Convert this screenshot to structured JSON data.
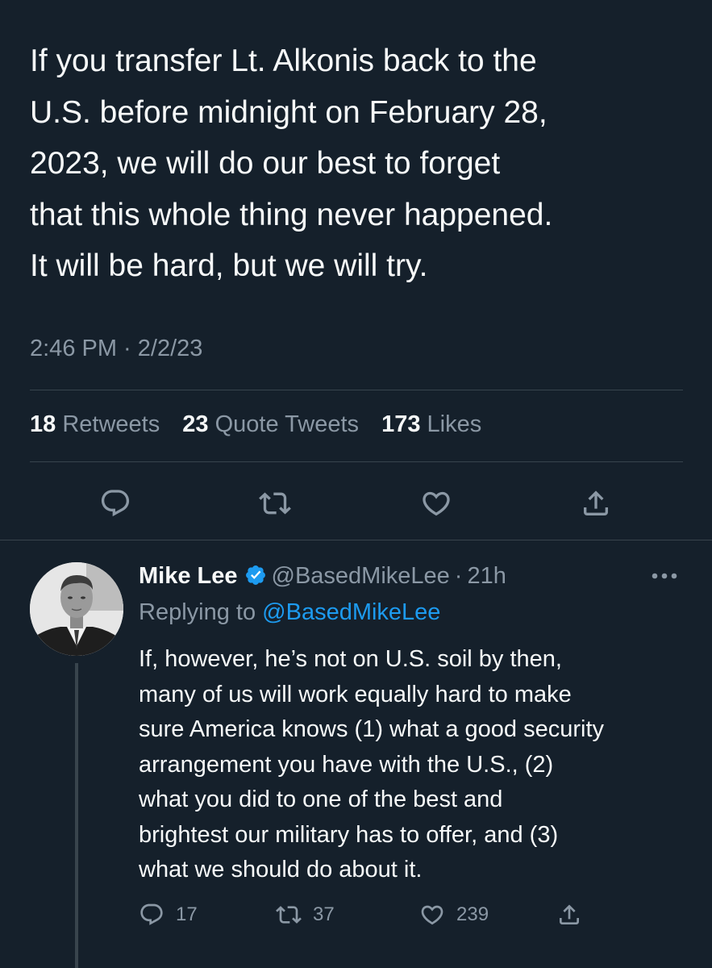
{
  "tweet": {
    "text_lines": [
      "If you transfer Lt. Alkonis back to the",
      "U.S. before midnight on February 28,",
      "2023, we will do our best to forget",
      "that this whole thing never happened.",
      "It will be hard, but we will try."
    ],
    "timestamp": "2:46 PM · 2/2/23",
    "stats": {
      "retweets_count": "18",
      "retweets_label": "Retweets",
      "quotes_count": "23",
      "quotes_label": "Quote Tweets",
      "likes_count": "173",
      "likes_label": "Likes"
    },
    "actions": [
      "reply-icon",
      "retweet-icon",
      "like-icon",
      "share-icon"
    ]
  },
  "reply": {
    "name": "Mike Lee",
    "handle": "@BasedMikeLee",
    "separator": "·",
    "time": "21h",
    "replying_to_label": "Replying to",
    "replying_to_handle": "@BasedMikeLee",
    "text_lines": [
      "If, however, he’s not on U.S. soil by then,",
      "many of us will work equally hard to make",
      "sure America knows (1) what a good security",
      "arrangement you have with the U.S., (2)",
      "what you did to one of the best and",
      "brightest our military has to offer, and (3)",
      "what we should do about it."
    ],
    "counts": {
      "replies": "17",
      "retweets": "37",
      "likes": "239"
    }
  },
  "colors": {
    "background": "#15202b",
    "primary_text": "#f7f9f9",
    "secondary_text": "#8b98a5",
    "link": "#1d9bf0",
    "divider": "#38444d",
    "verified": "#1d9bf0"
  }
}
